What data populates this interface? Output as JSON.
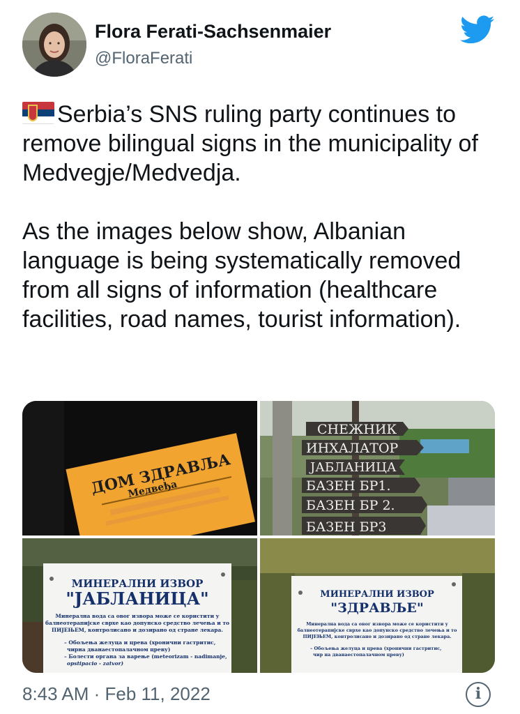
{
  "author": {
    "display_name": "Flora Ferati-Sachsenmaier",
    "handle": "@FloraFerati",
    "avatar_icon": "profile-avatar"
  },
  "brand": {
    "logo_icon": "twitter-bird-icon",
    "accent": "#1d9bf0"
  },
  "tweet": {
    "flag_icon": "serbia-flag-emoji",
    "paragraph_1": "Serbia’s SNS ruling party continues to remove bilingual signs in the municipality of Medvegje/Medvedja.",
    "paragraph_2": "As the images below show, Albanian language is being systematically removed from all signs of information (healthcare facilities, road names, tourist information)."
  },
  "media": {
    "photo_1": {
      "line1": "ДОМ ЗДРАВЉА",
      "line2": "Медвеђа"
    },
    "photo_2": {
      "signs": [
        "СНЕЖНИК",
        "ИНХАЛАТОР",
        "ЈАБЛАНИЦА",
        "БАЗЕН БР1.",
        "БАЗЕН БР 2.",
        "БАЗЕН БР3"
      ]
    },
    "photo_3": {
      "heading": "МИНЕРАЛНИ ИЗВОР",
      "title": "\"ЈАБЛАНИЦА\"",
      "body": [
        "Минерална вода са овог извора може се користити у",
        "балнеотерапијске сврхе као допунско средство лечења и то",
        "ПИЈЕЊЕМ, контролисано и дозирано од стране лекара."
      ],
      "bullets": [
        "– Обољења желуца и црева (хронични гастритис,",
        "чирна дванаестопалачном цреву)",
        "– Болести органа за варење (meteorizam - nadimanje,",
        "opstipacio - zatvor)"
      ]
    },
    "photo_4": {
      "heading": "МИНЕРАЛНИ ИЗВОР",
      "title": "\"ЗДРАВЉЕ\"",
      "body": [
        "Минерална вода са овог извора може се користити у",
        "балнеотерапијске сврхе као допунско средство лечења и то",
        "ПИЈЕЊЕМ, контролисано и дозирано од стране лекара."
      ],
      "bullets": [
        "– Обољења желуца и црева (хронични гастритис,",
        "чир на дванаестопалачном цреву)"
      ]
    }
  },
  "footer": {
    "timestamp": "8:43 AM · Feb 11, 2022",
    "info_icon": "info-icon",
    "info_glyph": "i"
  }
}
